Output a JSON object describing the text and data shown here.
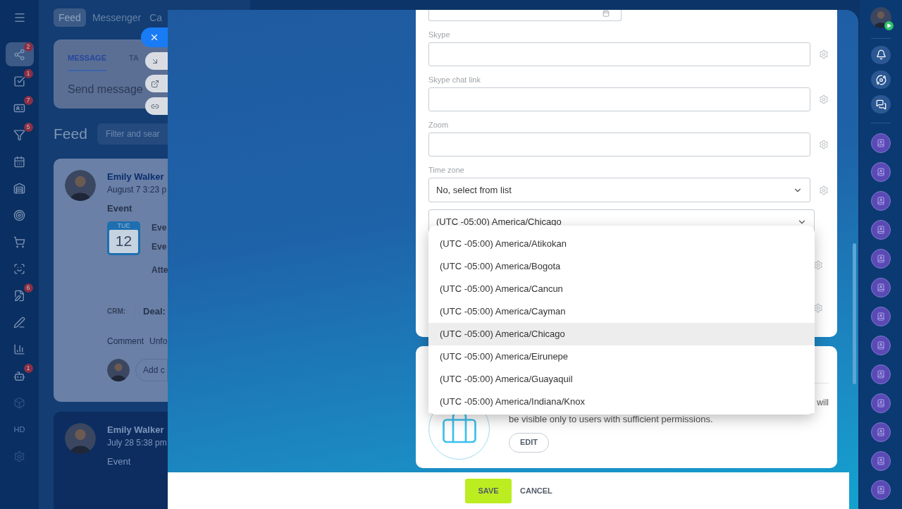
{
  "left_sidebar": {
    "items": [
      {
        "selected": true,
        "badge": "2"
      },
      {
        "selected": false,
        "badge": "1"
      },
      {
        "selected": false,
        "badge": "7"
      },
      {
        "selected": false,
        "badge": "5"
      },
      {
        "selected": false
      },
      {
        "selected": false
      },
      {
        "selected": false
      },
      {
        "selected": false
      },
      {
        "selected": false
      },
      {
        "selected": false,
        "badge": "6"
      },
      {
        "selected": false
      },
      {
        "selected": false
      },
      {
        "selected": false,
        "badge": "1"
      },
      {
        "selected": false
      },
      {
        "selected": false,
        "label": "HD"
      },
      {
        "selected": false
      }
    ]
  },
  "top_nav": {
    "tabs": [
      {
        "label": "Feed",
        "selected": true
      },
      {
        "label": "Messenger",
        "selected": false
      },
      {
        "label": "Ca",
        "selected": false
      }
    ]
  },
  "composer": {
    "tabs": [
      {
        "label": "MESSAGE",
        "selected": true
      },
      {
        "label": "TA",
        "selected": false
      }
    ],
    "placeholder": "Send message"
  },
  "feed": {
    "title": "Feed",
    "filter_placeholder": "Filter and sear"
  },
  "posts": [
    {
      "author": "Emily Walker",
      "time": "August 7 3:23 p",
      "type": "Event",
      "day": "TUE",
      "date": "12",
      "lines": [
        "Eve",
        "Eve",
        "Atte"
      ],
      "crm_label": "CRM:",
      "crm_value": "Deal:",
      "actions": [
        "Comment",
        "Unfo"
      ],
      "comment_placeholder": "Add c"
    },
    {
      "author": "Emily Walker",
      "time": "July 28 5:38 pm",
      "type": "Event"
    }
  ],
  "form": {
    "fields": [
      {
        "label": "Skype"
      },
      {
        "label": "Skype chat link"
      },
      {
        "label": "Zoom"
      }
    ],
    "time_zone": {
      "label": "Time zone",
      "mode": "No, select from list",
      "value": "(UTC -05:00) America/Chicago",
      "options": [
        {
          "label": "(UTC -05:00) America/Atikokan",
          "selected": false
        },
        {
          "label": "(UTC -05:00) America/Bogota",
          "selected": false
        },
        {
          "label": "(UTC -05:00) America/Cancun",
          "selected": false
        },
        {
          "label": "(UTC -05:00) America/Cayman",
          "selected": false
        },
        {
          "label": "(UTC -05:00) America/Chicago",
          "selected": true
        },
        {
          "label": "(UTC -05:00) America/Eirunepe",
          "selected": false
        },
        {
          "label": "(UTC -05:00) America/Guayaquil",
          "selected": false
        },
        {
          "label": "(UTC -05:00) America/Indiana/Knox",
          "selected": false
        }
      ]
    }
  },
  "permissions_card": {
    "text_end": "will",
    "text": "be visible only to users with sufficient permissions.",
    "button": "EDIT"
  },
  "footer": {
    "save": "SAVE",
    "cancel": "CANCEL"
  }
}
